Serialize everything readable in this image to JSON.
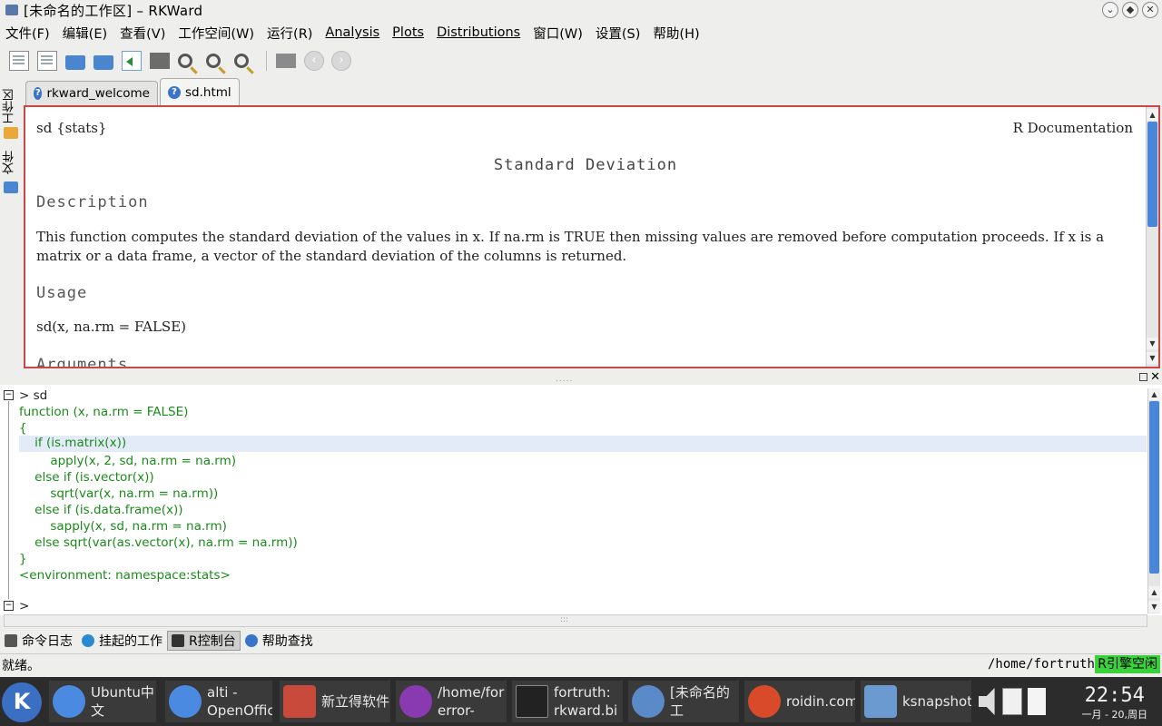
{
  "window": {
    "title": "[未命名的工作区] – RKWard"
  },
  "menubar": {
    "items": [
      "文件(F)",
      "编辑(E)",
      "查看(V)",
      "工作空间(W)",
      "运行(R)",
      "Analysis",
      "Plots",
      "Distributions",
      "窗口(W)",
      "设置(S)",
      "帮助(H)"
    ]
  },
  "sidebar": {
    "tab1": "工作区",
    "tab2": "文件"
  },
  "doc_tabs": [
    {
      "label": "rkward_welcome"
    },
    {
      "label": "sd.html"
    }
  ],
  "help": {
    "topic": "sd {stats}",
    "doc_label": "R Documentation",
    "title": "Standard Deviation",
    "description_heading": "Description",
    "description_text": "This function computes the standard deviation of the values in x. If na.rm is TRUE then missing values are removed before computation proceeds. If x is a matrix or a data frame, a vector of the standard deviation of the columns is returned.",
    "usage_heading": "Usage",
    "usage_text": "sd(x, na.rm = FALSE)",
    "arguments_heading": "Arguments"
  },
  "console": {
    "prompt_line": "> sd",
    "lines": [
      "function (x, na.rm = FALSE)",
      "{",
      "    if (is.matrix(x))",
      "        apply(x, 2, sd, na.rm = na.rm)",
      "    else if (is.vector(x))",
      "        sqrt(var(x, na.rm = na.rm))",
      "    else if (is.data.frame(x))",
      "        sapply(x, sd, na.rm = na.rm)",
      "    else sqrt(var(as.vector(x), na.rm = na.rm))",
      "}",
      "<environment: namespace:stats>"
    ],
    "last_prompt": ">"
  },
  "bottom_tabs": [
    "命令日志",
    "挂起的工作",
    "R控制台",
    "帮助查找"
  ],
  "status": {
    "left": "就绪。",
    "path": "/home/fortruth",
    "engine": "R引擎空闲"
  },
  "taskbar": {
    "tasks": [
      {
        "label": "Ubuntu中文"
      },
      {
        "label": "alti - OpenOffic"
      },
      {
        "label": "新立得软件"
      },
      {
        "label": "/home/for error-"
      },
      {
        "label": "fortruth: rkward.bi"
      },
      {
        "label": "[未命名的工"
      },
      {
        "label": "roidin.com"
      },
      {
        "label": "ksnapshot"
      }
    ],
    "clock_time": "22:54",
    "clock_date": "一月 - 20,周日"
  },
  "colors": {
    "accent": "#4a86d8",
    "console_text": "#1a8a1a",
    "engine_idle": "#3ad23a",
    "help_border": "#c84848"
  }
}
